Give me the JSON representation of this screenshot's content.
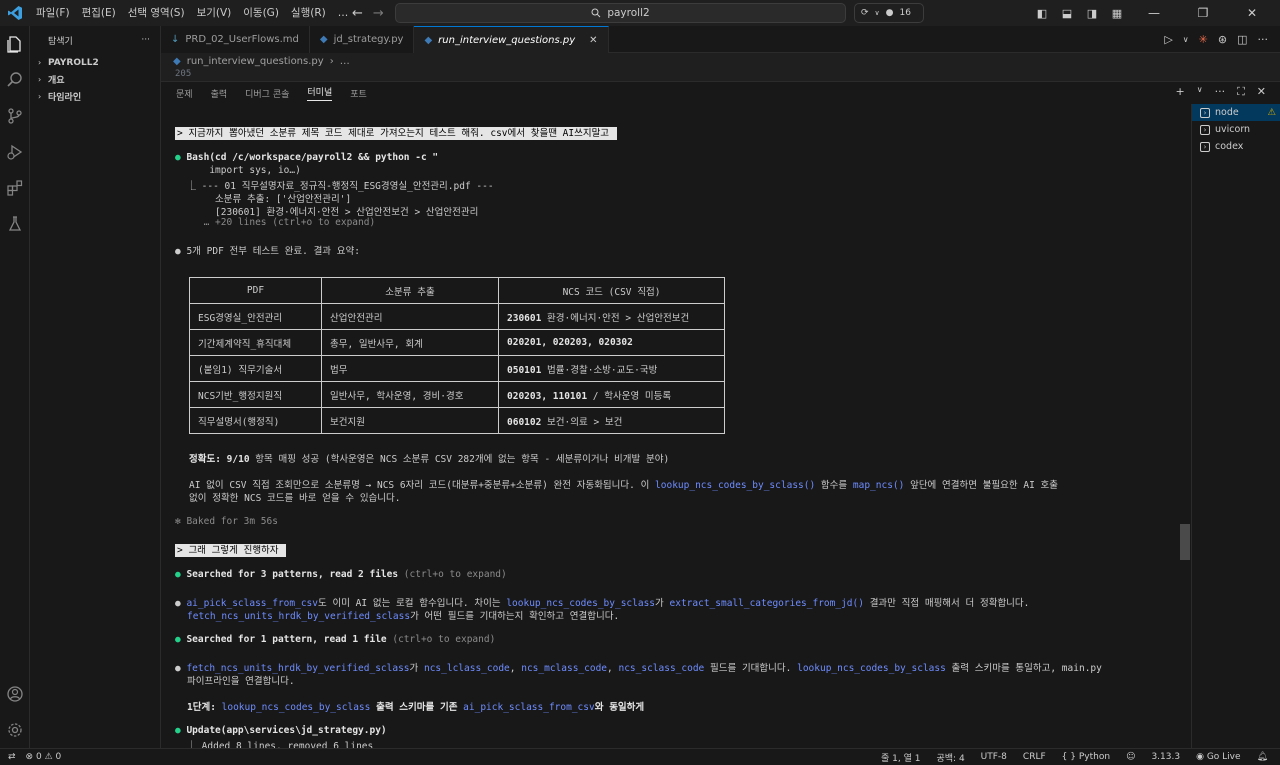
{
  "menu": [
    "파일(F)",
    "편집(E)",
    "선택 영역(S)",
    "보기(V)",
    "이동(G)",
    "실행(R)",
    "…"
  ],
  "search": {
    "text": "payroll2"
  },
  "copilot": {
    "count": "16"
  },
  "sidebar": {
    "title": "탐색기",
    "items": [
      {
        "label": "PAYROLL2",
        "bold": true
      },
      {
        "label": "개요"
      },
      {
        "label": "타임라인"
      }
    ]
  },
  "tabs": [
    {
      "label": "PRD_02_UserFlows.md"
    },
    {
      "label": "jd_strategy.py"
    },
    {
      "label": "run_interview_questions.py",
      "active": true
    }
  ],
  "breadcrumb": {
    "file": "run_interview_questions.py",
    "rest": "…"
  },
  "editor": {
    "line": "205"
  },
  "panel": {
    "tabs": [
      "문제",
      "출력",
      "디버그 콘솔",
      "터미널",
      "포트"
    ],
    "active": "터미널"
  },
  "terminal": {
    "prompt1": "> 지금까지 뽑아냈던 소분류 제목 코드 제대로 가져오는지 테스트 해줘. csv에서 찾을땐 AI쓰지말고 ",
    "bash1": "Bash(cd /c/workspace/payroll2 && python -c \"",
    "bash2": "      import sys, io…)",
    "bash3": "  ⎿ --- 01 직무설명자료_정규직-행정직_ESG경영실_안전관리.pdf ---",
    "bash4": "       소분류 추출: ['산업안전관리']",
    "bash5": "       [230601] 환경·에너지·안전 > 산업안전보건 > 산업안전관리",
    "bash6": "     … +20 lines (ctrl+o to expand)",
    "summary": "5개 PDF 전부 테스트 완료. 결과 요약:",
    "table_headers": [
      "PDF",
      "소분류 추출",
      "NCS 코드 (CSV 직접)"
    ],
    "table_rows": [
      [
        "ESG경영실_안전관리",
        "산업안전관리",
        "230601",
        " 환경·에너지·안전 > 산업안전보건"
      ],
      [
        "기간제계약직_휴직대체",
        "총무, 일반사무, 회계",
        "020201, 020203, 020302",
        ""
      ],
      [
        "(붙임1) 직무기술서",
        "법무",
        "050101",
        " 법률·경찰·소방·교도·국방"
      ],
      [
        "NCS기반_행정지원직",
        "일반사무, 학사운영, 경비·경호",
        "020203, 110101",
        " / 학사운영 미등록"
      ],
      [
        "직무설명서(행정직)",
        "보건지원",
        "060102",
        " 보건·의료 > 보건"
      ]
    ],
    "acc_bold": "정확도: 9/10",
    "acc_rest": " 항목 매핑 성공 (학사운영은 NCS 소분류 CSV 282개에 없는 항목 - 세분류이거나 비개발 분야)",
    "ai1a": "AI 없이 CSV 직접 조회만으로 소분류명 → NCS 6자리 코드(대분류+중분류+소분류) 완전 자동화됩니다. 이 ",
    "ai1b": "lookup_ncs_codes_by_sclass()",
    "ai1c": " 함수를 ",
    "ai1d": "map_ncs()",
    "ai1e": " 앞단에 연결하면 불필요한 AI 호출",
    "ai2": "없이 정확한 NCS 코드를 바로 얻을 수 있습니다.",
    "baked": "✻ Baked for 3m 56s",
    "prompt2": "> 그래 그렇게 진행하자 ",
    "searched1a": "Searched for 3 patterns, read 2 files",
    "searched1b": " (ctrl+o to expand)",
    "pick1a": "ai_pick_sclass_from_csv",
    "pick1b": "도 이미 AI 없는 로컬 함수입니다. 차이는 ",
    "pick1c": "lookup_ncs_codes_by_sclass",
    "pick1d": "가 ",
    "pick1e": "extract_small_categories_from_jd()",
    "pick1f": " 결과만 직접 매핑해서 더 정확합니다.",
    "pick2a": "fetch_ncs_units_hrdk_by_verified_sclass",
    "pick2b": "가 어떤 필드를 기대하는지 확인하고 연결합니다.",
    "searched2a": "Searched for 1 pattern, read 1 file",
    "searched2b": " (ctrl+o to expand)",
    "f1a": "fetch_ncs_units_hrdk_by_verified_sclass",
    "f1b": "가 ",
    "f1c": "ncs_lclass_code",
    "f1d": ", ",
    "f1e": "ncs_mclass_code",
    "f1f": ", ",
    "f1g": "ncs_sclass_code",
    "f1h": " 필드를 기대합니다. ",
    "f1i": "lookup_ncs_codes_by_sclass",
    "f1j": " 출력 스키마를 통일하고, main.py",
    "f2": "파이프라인을 연결합니다.",
    "step1a": "1단계: ",
    "step1b": "lookup_ncs_codes_by_sclass",
    "step1c": " 출력 스키마를 기존 ",
    "step1d": "ai_pick_sclass_from_csv",
    "step1e": "와 동일하게",
    "upd1": "Update(app\\services\\jd_strategy.py)",
    "upd2": "  ⎿ Added 8 lines, removed 6 lines"
  },
  "termlist": [
    {
      "label": "node",
      "warn": true
    },
    {
      "label": "uvicorn"
    },
    {
      "label": "codex"
    }
  ],
  "status": {
    "errors": "0",
    "warnings": "0",
    "pos": "줄 1, 열 1",
    "spaces": "공백: 4",
    "enc": "UTF-8",
    "eol": "CRLF",
    "lang": "Python",
    "ver": "3.13.3",
    "golive": "Go Live"
  },
  "colors": {
    "accent": "#0078d4",
    "green": "#23d18b",
    "link": "#6e8cff",
    "warn": "#cca700"
  }
}
